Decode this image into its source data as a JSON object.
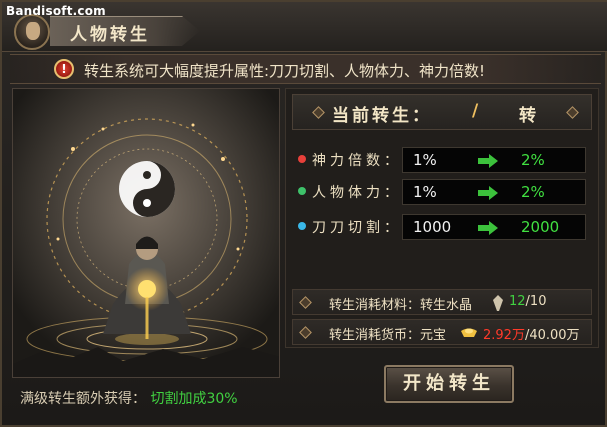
{
  "watermark": "Bandisoft.com",
  "window": {
    "title": "人物转生"
  },
  "banner": {
    "icon": "warning-icon",
    "text": "转生系统可大幅度提升属性:刀刀切割、人物体力、神力倍数!"
  },
  "current": {
    "label": "当前转生：",
    "value": "/",
    "unit": "转"
  },
  "stats": [
    {
      "name": "神力倍数：",
      "current": "1%",
      "next": "2%",
      "dot_color": "#e8403a"
    },
    {
      "name": "人物体力：",
      "current": "1%",
      "next": "2%",
      "dot_color": "#3ec26a"
    },
    {
      "name": "刀刀切割：",
      "current": "1000",
      "next": "2000",
      "dot_color": "#3ab8e8"
    }
  ],
  "costs": {
    "material": {
      "label": "转生消耗材料：转生水晶",
      "icon": "crystal-icon",
      "have": "12",
      "need": "/10"
    },
    "currency": {
      "label": "转生消耗货币：元宝",
      "icon": "gold-ingot-icon",
      "have": "2.92万",
      "need": "/40.00万"
    }
  },
  "footer": {
    "label": "满级转生额外获得：",
    "bonus": "切割加成30%"
  },
  "start_button": {
    "label": "开始转生"
  },
  "colors": {
    "accent_green": "#41d141",
    "accent_red": "#ff3a2a",
    "gold": "#f0c060"
  }
}
